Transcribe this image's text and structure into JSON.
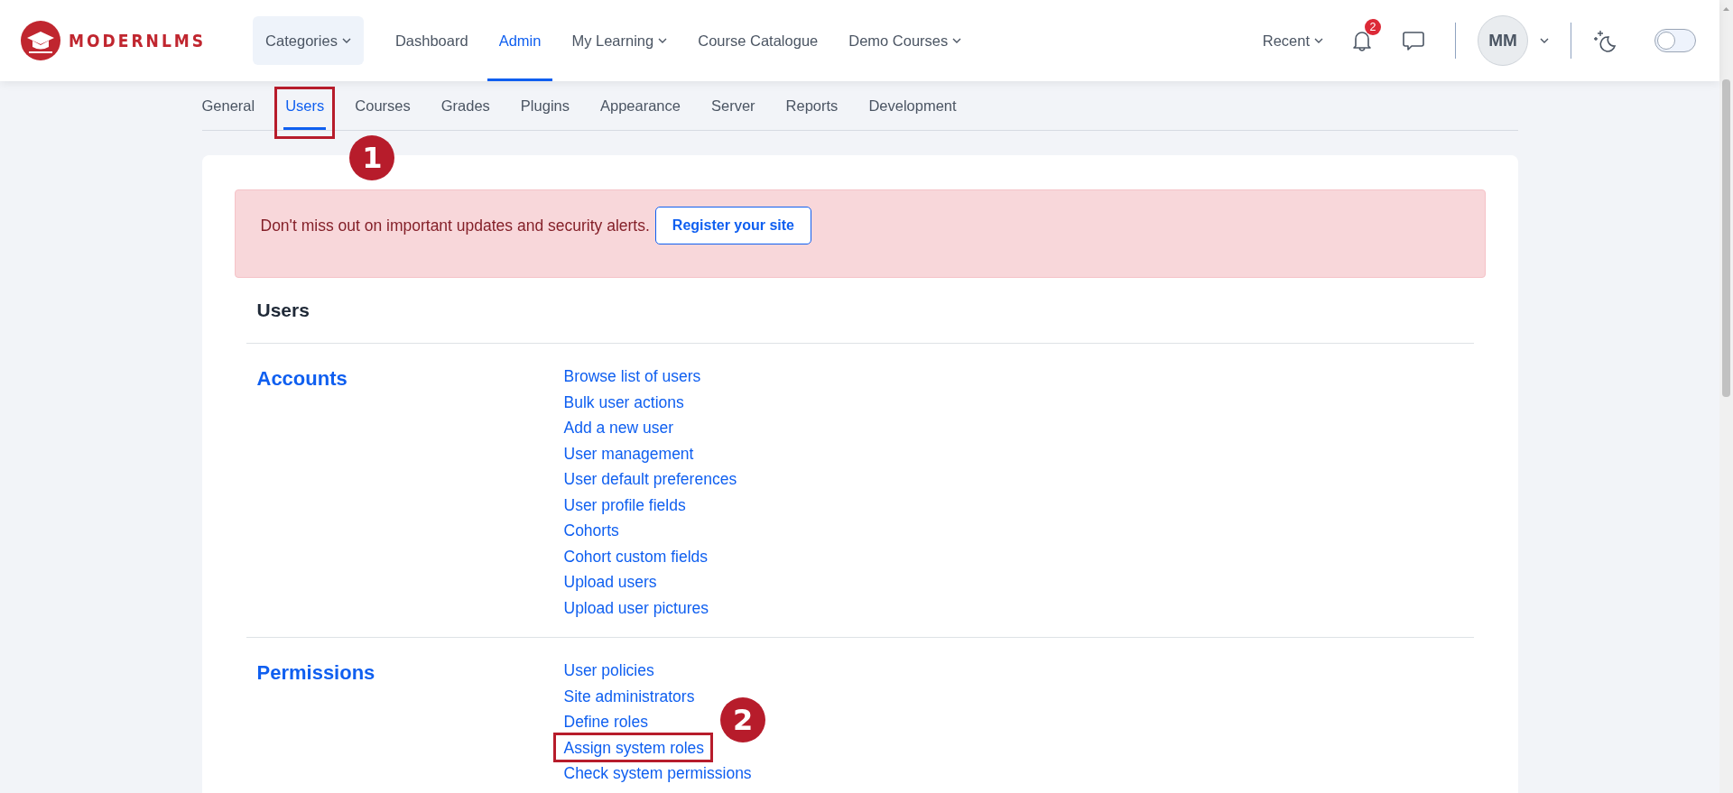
{
  "header": {
    "logo": "MODERNLMS",
    "nav": [
      {
        "label": "Categories",
        "kind": "button",
        "dropdown": true,
        "selected": false
      },
      {
        "label": "Dashboard",
        "kind": "link",
        "dropdown": false,
        "selected": false
      },
      {
        "label": "Admin",
        "kind": "link",
        "dropdown": false,
        "selected": true
      },
      {
        "label": "My Learning",
        "kind": "link",
        "dropdown": true,
        "selected": false
      },
      {
        "label": "Course Catalogue",
        "kind": "link",
        "dropdown": false,
        "selected": false
      },
      {
        "label": "Demo Courses",
        "kind": "link",
        "dropdown": true,
        "selected": false
      }
    ],
    "recent": "Recent",
    "notification_count": "2",
    "avatar_initials": "MM",
    "dark_mode": {
      "on": false
    }
  },
  "tabs": [
    {
      "label": "General",
      "selected": false
    },
    {
      "label": "Users",
      "selected": true,
      "callout": "1"
    },
    {
      "label": "Courses",
      "selected": false
    },
    {
      "label": "Grades",
      "selected": false
    },
    {
      "label": "Plugins",
      "selected": false
    },
    {
      "label": "Appearance",
      "selected": false
    },
    {
      "label": "Server",
      "selected": false
    },
    {
      "label": "Reports",
      "selected": false
    },
    {
      "label": "Development",
      "selected": false
    }
  ],
  "alert": {
    "text": "Don't miss out on important updates and security alerts.",
    "button": "Register your site"
  },
  "heading": "Users",
  "sections": [
    {
      "title": "Accounts",
      "links": [
        {
          "label": "Browse list of users"
        },
        {
          "label": "Bulk user actions"
        },
        {
          "label": "Add a new user"
        },
        {
          "label": "User management"
        },
        {
          "label": "User default preferences"
        },
        {
          "label": "User profile fields"
        },
        {
          "label": "Cohorts"
        },
        {
          "label": "Cohort custom fields"
        },
        {
          "label": "Upload users"
        },
        {
          "label": "Upload user pictures"
        }
      ]
    },
    {
      "title": "Permissions",
      "links": [
        {
          "label": "User policies"
        },
        {
          "label": "Site administrators"
        },
        {
          "label": "Define roles"
        },
        {
          "label": "Assign system roles",
          "callout": "2"
        },
        {
          "label": "Check system permissions"
        }
      ]
    }
  ]
}
